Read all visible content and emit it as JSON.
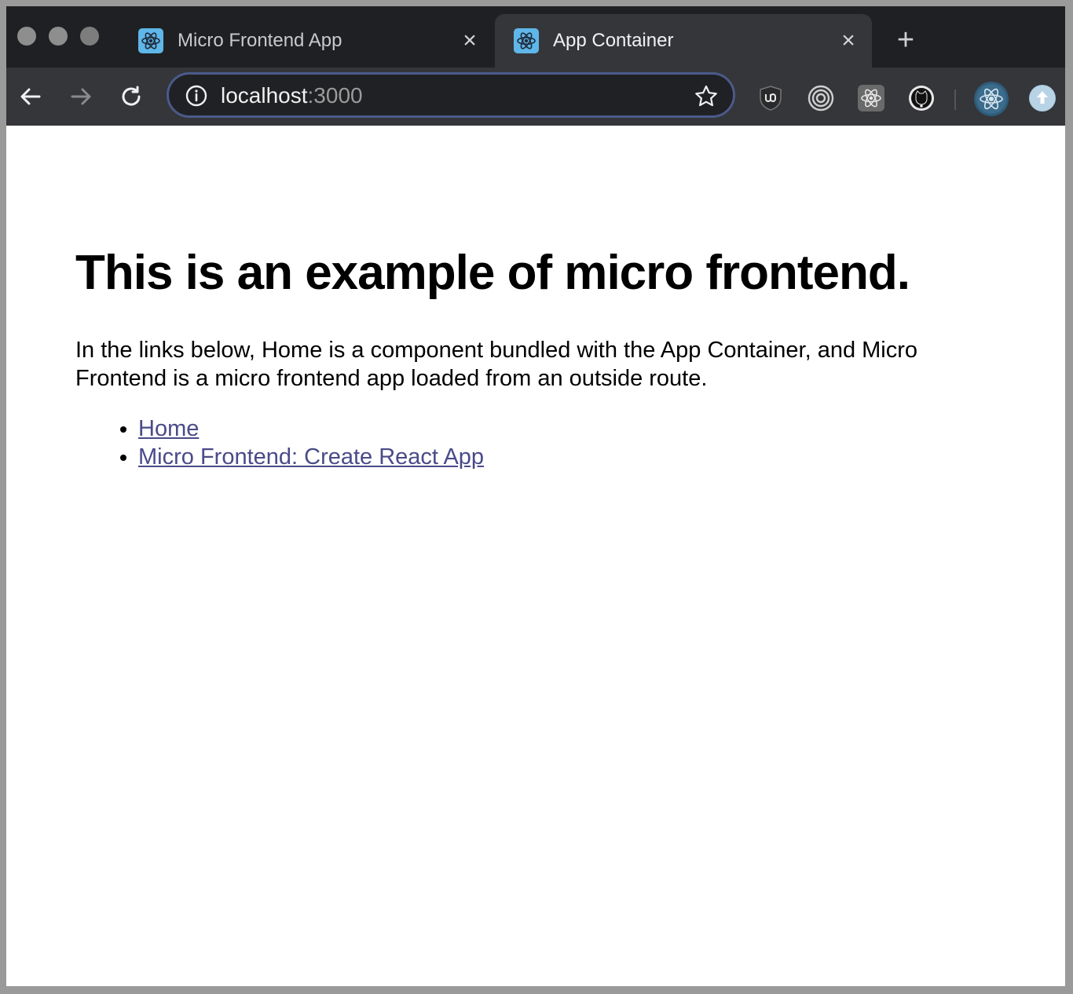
{
  "browser": {
    "tabs": [
      {
        "title": "Micro Frontend App",
        "active": false
      },
      {
        "title": "App Container",
        "active": true
      }
    ],
    "address_bar": {
      "host": "localhost",
      "port": ":3000"
    }
  },
  "page": {
    "title": "This is an example of micro frontend.",
    "intro": "In the links below, Home is a component bundled with the App Container, and Micro Frontend is a micro frontend app loaded from an outside route.",
    "links": [
      "Home",
      "Micro Frontend: Create React App"
    ]
  },
  "colors": {
    "link": "#4a4a8a",
    "tabstrip": "#1f2023",
    "toolbar": "#35363a",
    "favicon": "#5fb6e8"
  }
}
